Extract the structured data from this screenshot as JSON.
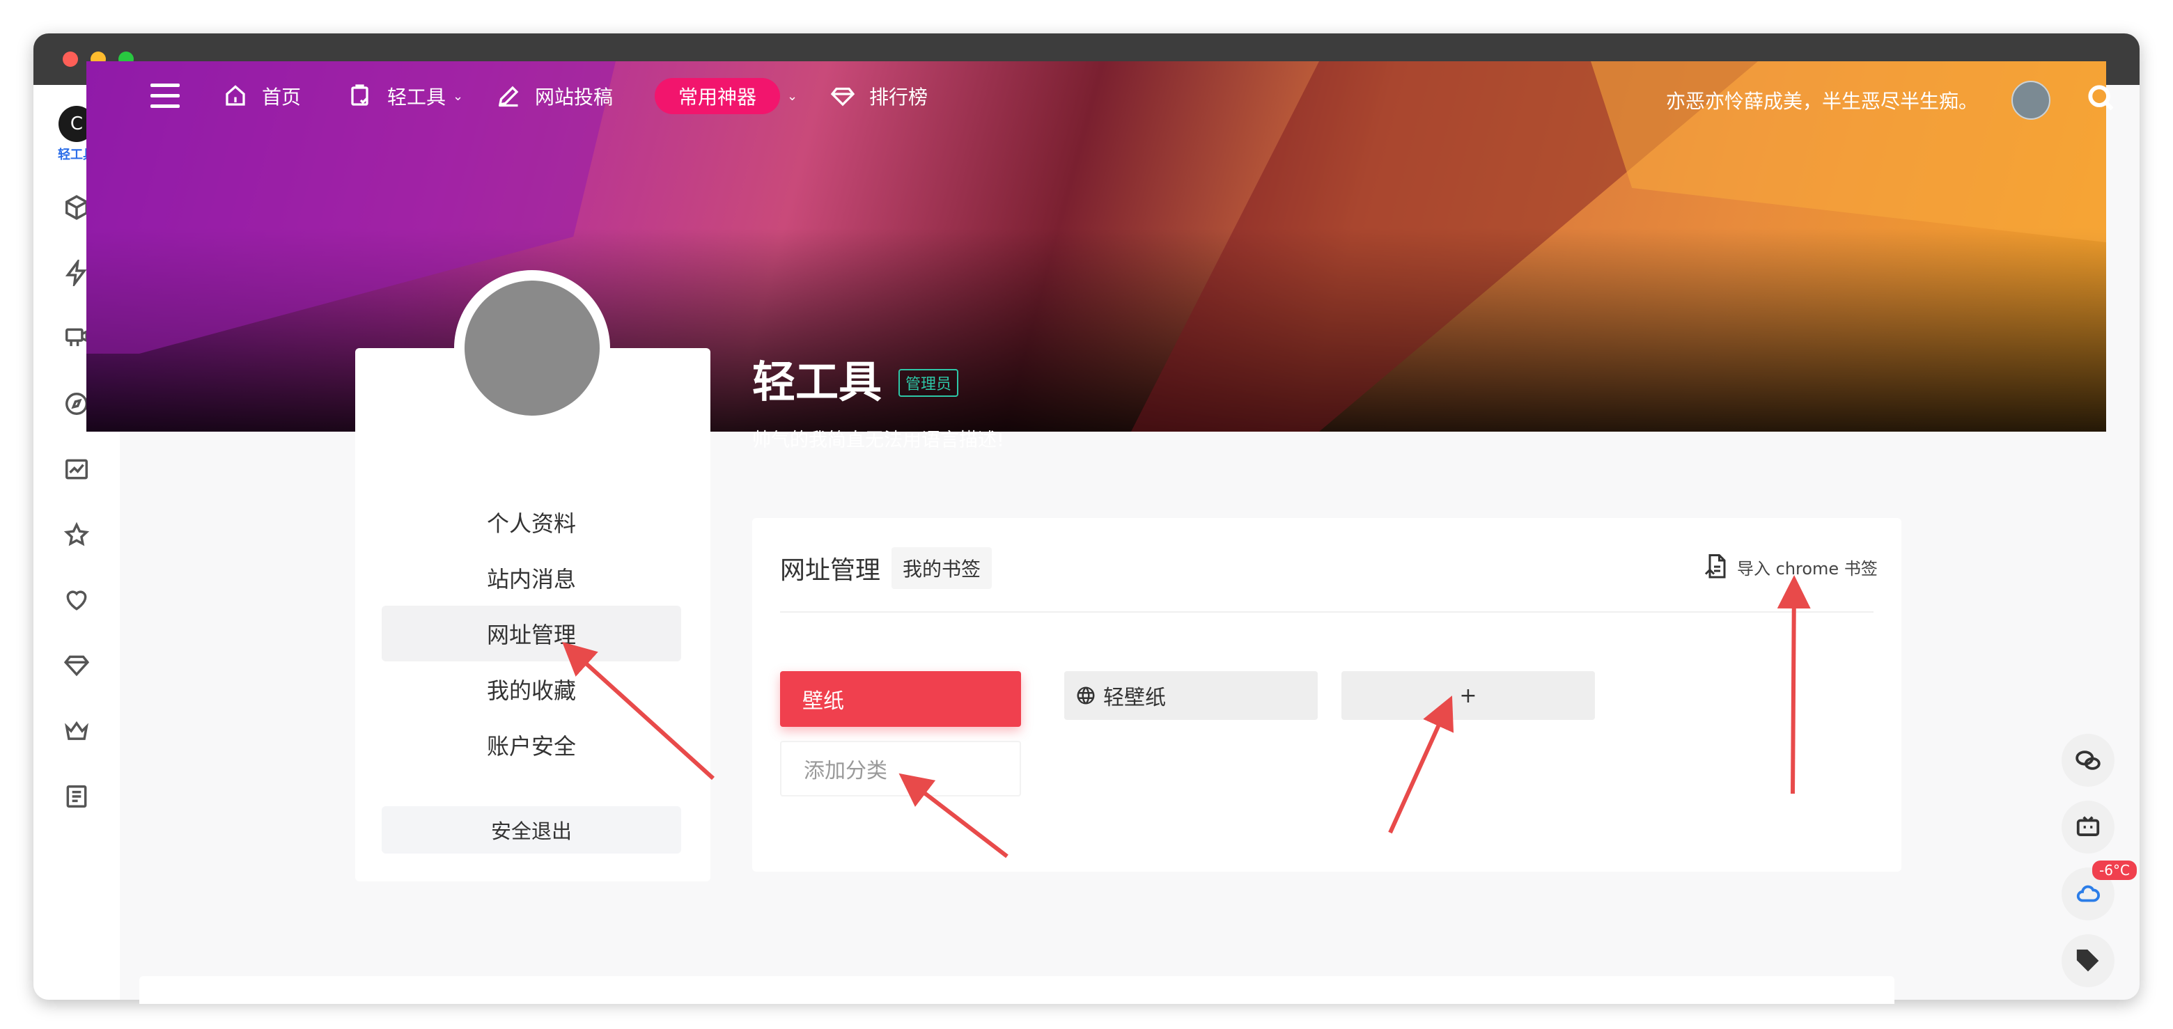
{
  "site": {
    "logo_text": "轻工具",
    "logo_glyph": "C"
  },
  "nav": {
    "home": "首页",
    "tools": "轻工具",
    "submit": "网站投稿",
    "featured": "常用神器",
    "ranking": "排行榜",
    "motto": "亦恶亦怜薛成美，半生恶尽半生痴。",
    "chevron": "⌄"
  },
  "profile": {
    "name": "轻工具",
    "role_badge": "管理员",
    "bio": "帅气的我简直无法用语言描述!"
  },
  "menu": {
    "items": [
      "个人资料",
      "站内消息",
      "网址管理",
      "我的收藏",
      "账户安全"
    ],
    "active": "网址管理",
    "logout": "安全退出"
  },
  "content": {
    "title": "网址管理",
    "tab": "我的书签",
    "import": "导入 chrome 书签",
    "category_active": "壁纸",
    "category_add": "添加分类",
    "site_name": "轻壁纸",
    "add_site": "+"
  },
  "float": {
    "weather_temp": "-6°C"
  },
  "colors": {
    "accent_red": "#f0404e",
    "pill_pink": "#f2156d",
    "admin_badge": "#2ec7a7",
    "logo_blue": "#2b6de8"
  }
}
